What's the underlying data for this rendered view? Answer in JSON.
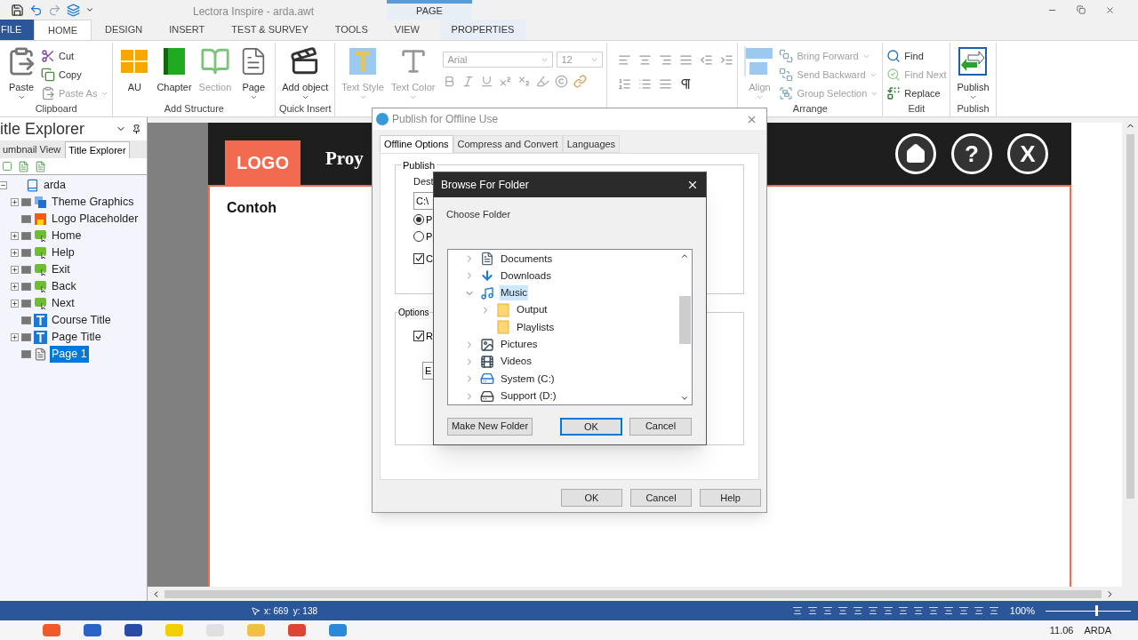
{
  "app": {
    "title": "Lectora Inspire - arda.awt",
    "context_group": "PAGE"
  },
  "ribbon_tabs": [
    {
      "label": "FILE",
      "kind": "file",
      "selected": false
    },
    {
      "label": "HOME",
      "kind": "normal",
      "selected": true
    },
    {
      "label": "DESIGN",
      "kind": "normal",
      "selected": false
    },
    {
      "label": "INSERT",
      "kind": "normal",
      "selected": false
    },
    {
      "label": "TEST & SURVEY",
      "kind": "normal",
      "selected": false
    },
    {
      "label": "TOOLS",
      "kind": "normal",
      "selected": false
    },
    {
      "label": "VIEW",
      "kind": "normal",
      "selected": false
    },
    {
      "label": "PROPERTIES",
      "kind": "context",
      "selected": false
    }
  ],
  "ribbon_groups": [
    {
      "label": "Clipboard",
      "large": [
        {
          "label": "Paste",
          "disabled": false,
          "dropdown": true
        }
      ],
      "small": [
        {
          "label": "Cut",
          "disabled": false,
          "dropdown": false
        },
        {
          "label": "Copy",
          "disabled": false,
          "dropdown": false
        },
        {
          "label": "Paste As",
          "disabled": true,
          "dropdown": true
        }
      ]
    },
    {
      "label": "Add Structure",
      "large": [
        {
          "label": "AU",
          "disabled": false,
          "dropdown": false
        },
        {
          "label": "Chapter",
          "disabled": false,
          "dropdown": false
        },
        {
          "label": "Section",
          "disabled": true,
          "dropdown": false
        },
        {
          "label": "Page",
          "disabled": false,
          "dropdown": true
        }
      ]
    },
    {
      "label": "Quick Insert",
      "large": [
        {
          "label": "Add object",
          "disabled": false,
          "dropdown": true
        }
      ]
    },
    {
      "kind": "font",
      "large": [
        {
          "label": "Text Style",
          "disabled": true,
          "dropdown": true
        },
        {
          "label": "Text Color",
          "disabled": true,
          "dropdown": true
        }
      ],
      "font": "Arial",
      "size": "12"
    },
    {
      "kind": "paragraph"
    },
    {
      "label": "Arrange",
      "large": [
        {
          "label": "Align",
          "disabled": true,
          "dropdown": true
        }
      ],
      "small": [
        {
          "label": "Bring Forward",
          "disabled": true,
          "dropdown": true
        },
        {
          "label": "Send Backward",
          "disabled": true,
          "dropdown": true
        },
        {
          "label": "Group Selection",
          "disabled": true,
          "dropdown": true
        }
      ]
    },
    {
      "label": "Edit",
      "small": [
        {
          "label": "Find",
          "disabled": false,
          "dropdown": false
        },
        {
          "label": "Find Next",
          "disabled": true,
          "dropdown": false
        },
        {
          "label": "Replace",
          "disabled": false,
          "dropdown": false
        }
      ]
    },
    {
      "label": "Publish",
      "large": [
        {
          "label": "Publish",
          "disabled": false,
          "dropdown": true
        }
      ]
    }
  ],
  "explorer": {
    "title": "itle Explorer",
    "tabs": [
      {
        "label": "umbnail View",
        "selected": false
      },
      {
        "label": "Title Explorer",
        "selected": true
      }
    ],
    "tree": [
      {
        "label": "arda",
        "kind": "book",
        "expandable": true,
        "expanded": true,
        "selected": false,
        "children": [
          {
            "label": "Theme Graphics",
            "kind": "theme",
            "expandable": true,
            "selected": false
          },
          {
            "label": "Logo Placeholder",
            "kind": "image",
            "expandable": false,
            "selected": false
          },
          {
            "label": "Home",
            "kind": "button",
            "expandable": true,
            "selected": false
          },
          {
            "label": "Help",
            "kind": "button",
            "expandable": true,
            "selected": false
          },
          {
            "label": "Exit",
            "kind": "button",
            "expandable": true,
            "selected": false
          },
          {
            "label": "Back",
            "kind": "button",
            "expandable": true,
            "selected": false
          },
          {
            "label": "Next",
            "kind": "button",
            "expandable": true,
            "selected": false
          },
          {
            "label": "Course Title",
            "kind": "text",
            "expandable": false,
            "selected": false
          },
          {
            "label": "Page Title",
            "kind": "text",
            "expandable": true,
            "selected": false
          },
          {
            "label": "Page 1",
            "kind": "page",
            "expandable": false,
            "selected": true
          }
        ]
      }
    ]
  },
  "page": {
    "logo": "LOGO",
    "title": "Proy",
    "heading": "Contoh",
    "nav": [
      {
        "kind": "home"
      },
      {
        "kind": "text",
        "label": "?"
      },
      {
        "kind": "text",
        "label": "X"
      }
    ]
  },
  "publish_dialog": {
    "title": "Publish for Offline Use",
    "tabs": [
      {
        "label": "Offline Options",
        "selected": true
      },
      {
        "label": "Compress and Convert",
        "selected": false
      },
      {
        "label": "Languages",
        "selected": false
      }
    ],
    "publish_group": "Publish",
    "dest_label": "Dest",
    "dest_value": "C:\\",
    "radios": [
      {
        "label": "P",
        "selected": true
      },
      {
        "label": "P",
        "selected": false
      }
    ],
    "checkbox": {
      "label": "C",
      "checked": true
    },
    "options_group": "Options",
    "option_checkbox": {
      "label": "R",
      "checked": true
    },
    "option_field": "E",
    "buttons": [
      "OK",
      "Cancel",
      "Help"
    ]
  },
  "browse_dialog": {
    "title": "Browse For Folder",
    "prompt": "Choose Folder",
    "tree": [
      {
        "label": "Documents",
        "kind": "documents",
        "expandable": true,
        "selected": false
      },
      {
        "label": "Downloads",
        "kind": "downloads",
        "expandable": true,
        "selected": false
      },
      {
        "label": "Music",
        "kind": "music",
        "expandable": true,
        "expanded": true,
        "selected": true,
        "children": [
          {
            "label": "Output",
            "kind": "folder",
            "expandable": true,
            "selected": false
          },
          {
            "label": "Playlists",
            "kind": "folder",
            "expandable": false,
            "selected": false
          }
        ]
      },
      {
        "label": "Pictures",
        "kind": "pictures",
        "expandable": true,
        "selected": false
      },
      {
        "label": "Videos",
        "kind": "videos",
        "expandable": true,
        "selected": false
      },
      {
        "label": "System (C:)",
        "kind": "system",
        "expandable": true,
        "selected": false
      },
      {
        "label": "Support (D:)",
        "kind": "drive",
        "expandable": true,
        "selected": false
      }
    ],
    "buttons": [
      {
        "label": "Make New Folder",
        "default": false
      },
      {
        "label": "OK",
        "default": true
      },
      {
        "label": "Cancel",
        "default": false
      }
    ]
  },
  "status_bar": {
    "coordinates": "x: 669  y: 138",
    "zoom": "100%",
    "zoom_level": {
      "level": 0.6
    }
  },
  "taskbar": {
    "time": "11.06",
    "user": "ARDA"
  }
}
